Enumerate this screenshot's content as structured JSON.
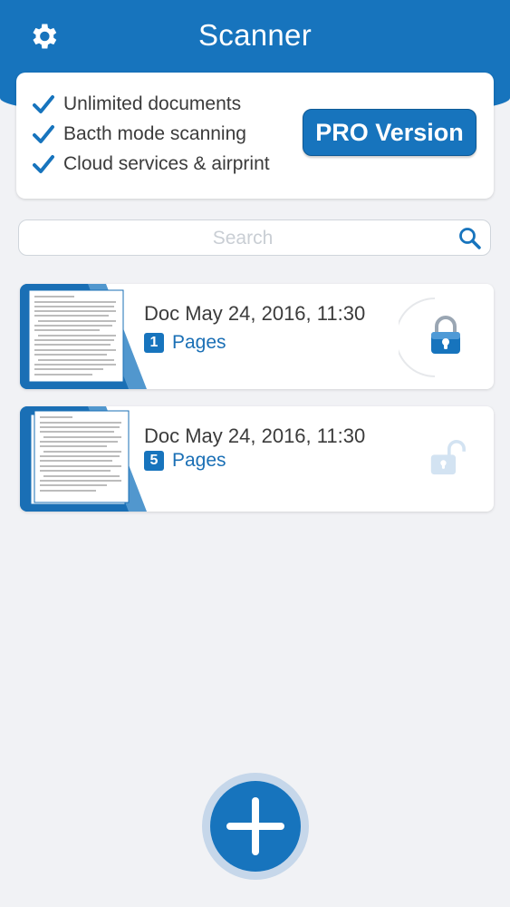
{
  "header": {
    "title": "Scanner",
    "settings_icon": "gear-icon",
    "color": "#1774bd"
  },
  "promo": {
    "features": [
      "Unlimited documents",
      "Bacth mode scanning",
      "Cloud services & airprint"
    ],
    "pro_button_label": "PRO Version"
  },
  "search": {
    "placeholder": "Search",
    "value": "",
    "icon": "search-icon"
  },
  "documents": [
    {
      "title": "Doc May 24, 2016, 11:30",
      "page_count": "1",
      "pages_label": "Pages",
      "lock_state": "locked",
      "icon": "lock-closed-icon"
    },
    {
      "title": "Doc May 24, 2016, 11:30",
      "page_count": "5",
      "pages_label": "Pages",
      "lock_state": "unlocked",
      "icon": "lock-open-icon"
    }
  ],
  "fab": {
    "icon": "plus-icon"
  }
}
